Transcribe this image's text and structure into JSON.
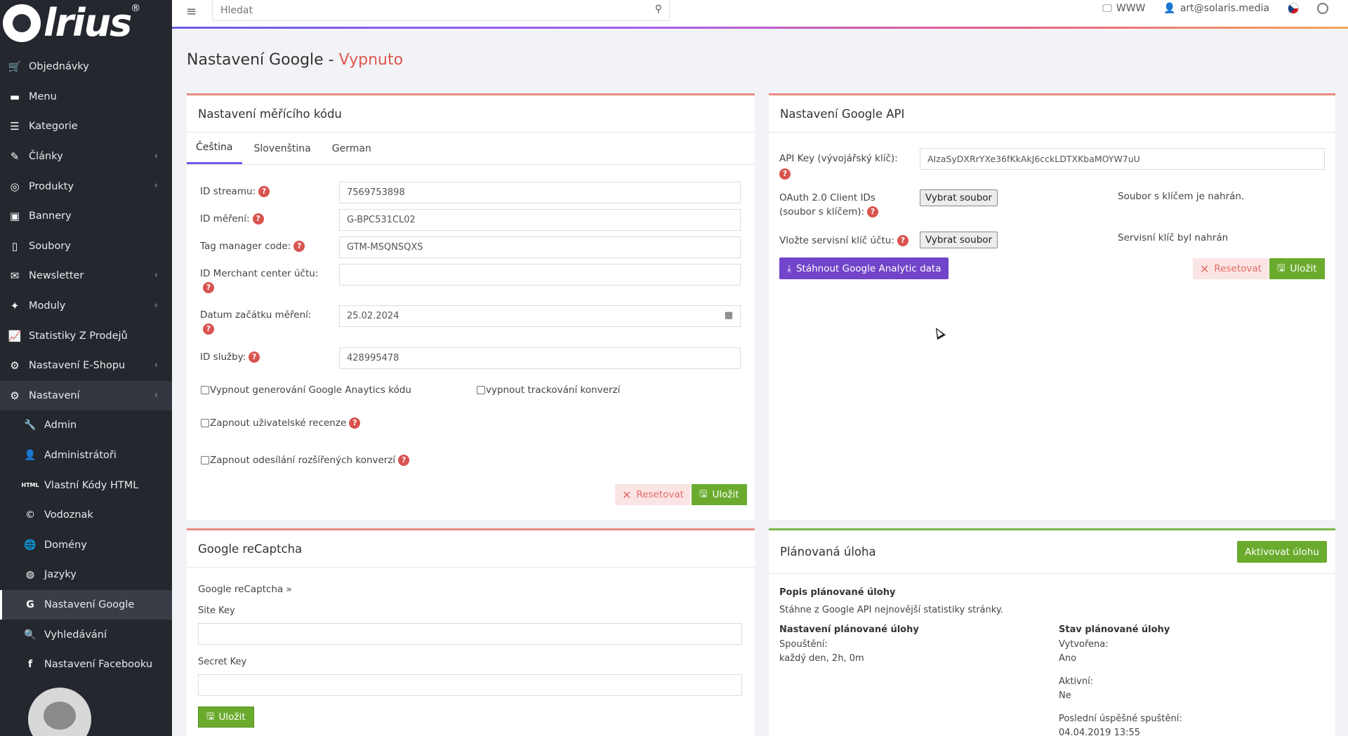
{
  "app": {
    "logo_text": "lrius",
    "logo_reg": "®"
  },
  "search": {
    "placeholder": "Hledat"
  },
  "topbar": {
    "www_label": "WWW",
    "user_email": "art@solaris.media"
  },
  "sidebar": {
    "items": [
      {
        "label": "Objednávky",
        "icon": "cart-icon"
      },
      {
        "label": "Menu",
        "icon": "folder-icon"
      },
      {
        "label": "Kategorie",
        "icon": "list-icon"
      },
      {
        "label": "Články",
        "icon": "pencil-icon"
      },
      {
        "label": "Produkty",
        "icon": "ball-icon"
      },
      {
        "label": "Bannery",
        "icon": "image-icon"
      },
      {
        "label": "Soubory",
        "icon": "file-icon"
      },
      {
        "label": "Newsletter",
        "icon": "mail-icon"
      },
      {
        "label": "Moduly",
        "icon": "modules-icon"
      },
      {
        "label": "Statistiky Z Prodejů",
        "icon": "chart-icon"
      },
      {
        "label": "Nastavení E-Shopu",
        "icon": "cogs-icon"
      },
      {
        "label": "Nastavení",
        "icon": "cogs-icon"
      }
    ],
    "sub_items": [
      {
        "label": "Admin",
        "icon": "wrench-icon"
      },
      {
        "label": "Administrátoři",
        "icon": "user-icon"
      },
      {
        "label": "Vlastní Kódy HTML",
        "icon": "html-icon"
      },
      {
        "label": "Vodoznak",
        "icon": "copyright-icon"
      },
      {
        "label": "Domény",
        "icon": "globe-icon"
      },
      {
        "label": "Jazyky",
        "icon": "language-globe-icon"
      },
      {
        "label": "Nastavení Google",
        "icon": "google-icon"
      },
      {
        "label": "Vyhledávání",
        "icon": "search-icon"
      },
      {
        "label": "Nastavení Facebooku",
        "icon": "facebook-icon"
      }
    ]
  },
  "page": {
    "title": "Nastavení Google - ",
    "status": "Vypnuto"
  },
  "tracking": {
    "header": "Nastavení měřícího kódu",
    "tabs": [
      "Čeština",
      "Slovenština",
      "German"
    ],
    "stream_label": "ID streamu:",
    "stream_value": "7569753898",
    "measure_label": "ID měření:",
    "measure_value": "G-BPC531CL02",
    "tag_label": "Tag manager code:",
    "tag_value": "GTM-MSQNSQXS",
    "merchant_label": "ID Merchant center účtu:",
    "merchant_value": "",
    "date_label": "Datum začátku měření:",
    "date_value": "25.02.2024",
    "service_label": "ID služby:",
    "service_value": "428995478",
    "cb1": "Vypnout generování Google Anaytics kódu",
    "cb2": "vypnout trackování konverzí",
    "cb3": "Zapnout uživatelské recenze",
    "cb4": "Zapnout odesílání rozšířených konverzí",
    "reset": "Resetovat",
    "save": "Uložit"
  },
  "api": {
    "header": "Nastavení Google API",
    "key_label": "API Key (vývojářský klíč):",
    "key_value": "AIzaSyDXRrYXe36fKkAkJ6cckLDTXKbaMOYW7uU",
    "oauth_label_1": "OAuth 2.0 Client IDs",
    "oauth_label_2": "(soubor s klíčem):",
    "file_btn": "Vybrat soubor",
    "oauth_status": "Soubor s klíčem je nahrán.",
    "service_label": "Vložte servisní klíč účtu:",
    "service_status": "Servisní klíč byl nahrán",
    "download": "Stáhnout Google Analytic data",
    "reset": "Resetovat",
    "save": "Uložit"
  },
  "recaptcha": {
    "header": "Google reCaptcha",
    "link": "Google reCaptcha »",
    "site_key_label": "Site Key",
    "secret_key_label": "Secret Key",
    "save": "Uložit"
  },
  "task": {
    "header": "Plánovaná úloha",
    "activate": "Aktivovat úlohu",
    "desc_title": "Popis plánované úlohy",
    "desc_text": "Stáhne z Google API nejnovější statistiky stránky.",
    "settings_title": "Nastavení plánované úlohy",
    "run_label": "Spouštění:",
    "run_value": "každý den, 2h, 0m",
    "state_title": "Stav plánované úlohy",
    "created_label": "Vytvořena:",
    "created_value": "Ano",
    "active_label": "Aktivní:",
    "active_value": "Ne",
    "last_label": "Poslední úspěšné spuštění:",
    "last_value": "04.04.2019 13:55"
  },
  "colors": {
    "accent": "#6c5ce7",
    "danger": "#e0564e",
    "success": "#6aab2e",
    "sidebar_bg": "#24272e"
  }
}
